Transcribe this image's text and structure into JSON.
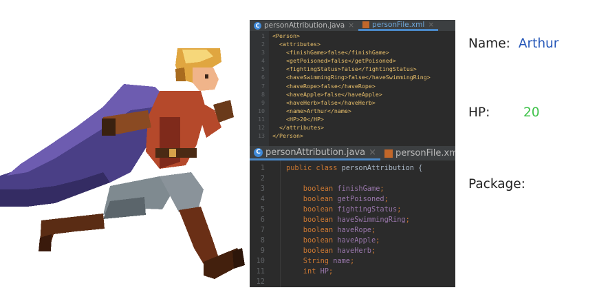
{
  "colors": {
    "name_value": "#2456b8",
    "hp_value": "#3fc24a",
    "editor_bg": "#2b2b2b",
    "xml_tag": "#e8bf6a",
    "keyword": "#cc7832",
    "field": "#9876aa"
  },
  "sprite": {
    "icon": "knight-running-sprite-icon"
  },
  "xml_editor": {
    "tabs": [
      {
        "label": "personAttribution.java",
        "icon": "java-class-icon",
        "active": false
      },
      {
        "label": "personFile.xml",
        "icon": "xml-file-icon",
        "active": true
      }
    ],
    "line_numbers": [
      "1",
      "2",
      "3",
      "4",
      "5",
      "6",
      "7",
      "8",
      "9",
      "10",
      "11",
      "12",
      "13"
    ],
    "lines": [
      {
        "indent": "",
        "text": "<Person>"
      },
      {
        "indent": "  ",
        "text": "<attributes>"
      },
      {
        "indent": "    ",
        "text": "<finishGame>false</finishGame>"
      },
      {
        "indent": "    ",
        "text": "<getPoisoned>false</getPoisoned>"
      },
      {
        "indent": "    ",
        "text": "<fightingStatus>false</fightingStatus>"
      },
      {
        "indent": "    ",
        "text": "<haveSwimmingRing>false</haveSwimmingRing>"
      },
      {
        "indent": "    ",
        "text": "<haveRope>false</haveRope>"
      },
      {
        "indent": "    ",
        "text": "<haveApple>false</haveApple>"
      },
      {
        "indent": "    ",
        "text": "<haveHerb>false</haveHerb>"
      },
      {
        "indent": "    ",
        "text": "<name>Arthur</name>"
      },
      {
        "indent": "    ",
        "text": "<HP>20</HP>"
      },
      {
        "indent": "  ",
        "text": "</attributes>"
      },
      {
        "indent": "",
        "text": "</Person>"
      }
    ]
  },
  "java_editor": {
    "tabs": [
      {
        "label": "personAttribution.java",
        "icon": "java-class-icon",
        "active": true
      },
      {
        "label": "personFile.xml",
        "icon": "xml-file-icon",
        "active": false
      }
    ],
    "line_numbers": [
      "1",
      "2",
      "3",
      "4",
      "5",
      "6",
      "7",
      "8",
      "9",
      "10",
      "11",
      "12"
    ],
    "lines": [
      {
        "kw": "public class ",
        "name": "personAttribution {",
        "pun": ""
      },
      {
        "kw": "",
        "name": "",
        "pun": ""
      },
      {
        "kw": "    boolean ",
        "name": "finishGame",
        "pun": ";"
      },
      {
        "kw": "    boolean ",
        "name": "getPoisoned",
        "pun": ";"
      },
      {
        "kw": "    boolean ",
        "name": "fightingStatus",
        "pun": ";"
      },
      {
        "kw": "    boolean ",
        "name": "haveSwimmingRing",
        "pun": ";"
      },
      {
        "kw": "    boolean ",
        "name": "haveRope",
        "pun": ";"
      },
      {
        "kw": "    boolean ",
        "name": "haveApple",
        "pun": ";"
      },
      {
        "kw": "    boolean ",
        "name": "haveHerb",
        "pun": ";"
      },
      {
        "kw": "    String ",
        "name": "name",
        "pun": ";"
      },
      {
        "kw": "    int ",
        "name": "HP",
        "pun": ";"
      },
      {
        "kw": "",
        "name": "",
        "pun": ""
      }
    ]
  },
  "info": {
    "name_label": "Name:",
    "name_value": "Arthur",
    "hp_label": "HP:",
    "hp_value": "20",
    "package_label": "Package:"
  }
}
